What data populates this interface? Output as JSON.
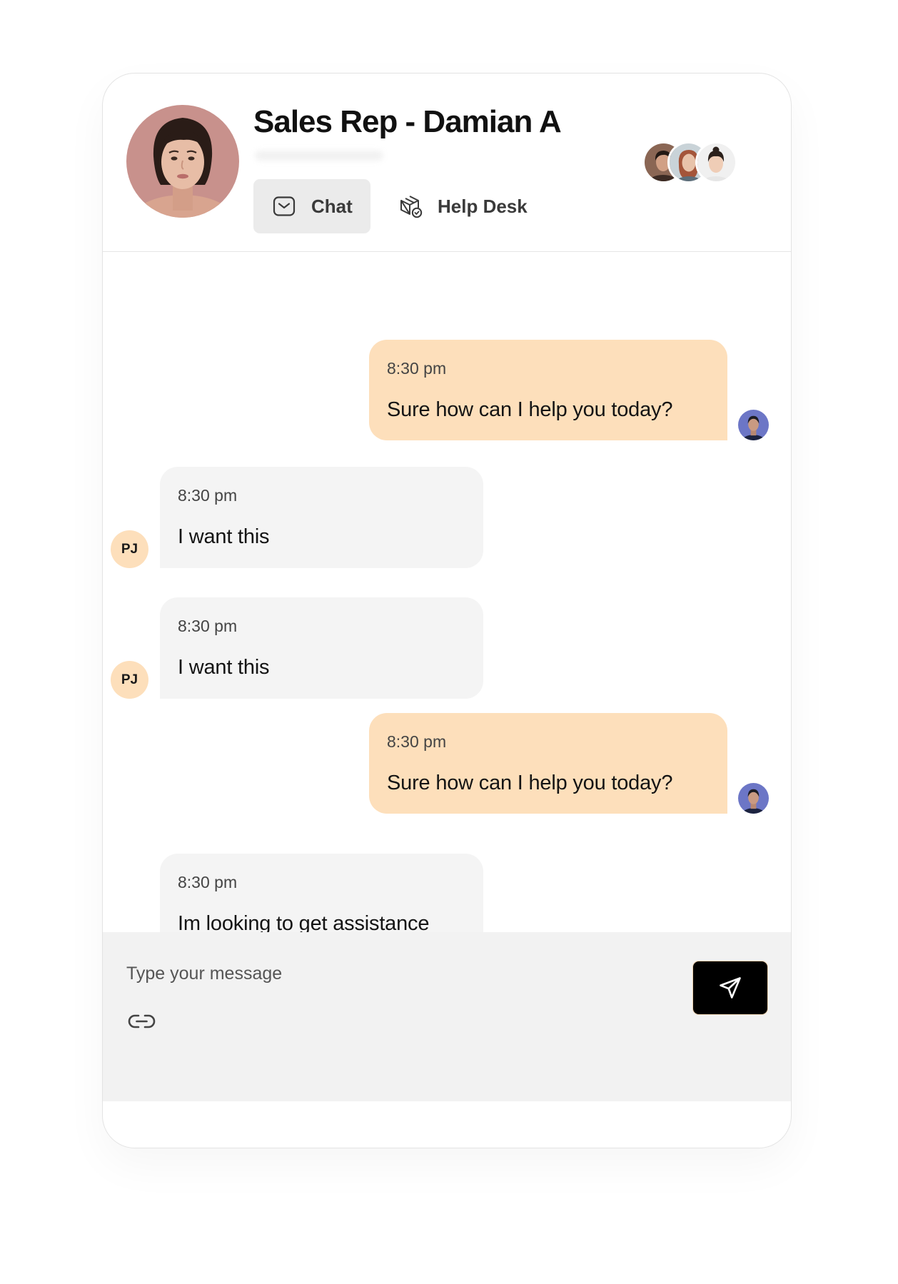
{
  "header": {
    "title": "Sales Rep - Damian A",
    "tabs": [
      {
        "label": "Chat",
        "icon": "mail-icon",
        "active": true
      },
      {
        "label": "Help Desk",
        "icon": "package-check-icon",
        "active": false
      }
    ]
  },
  "messages": [
    {
      "direction": "outgoing",
      "time": "8:30 pm",
      "text": "Sure how can I help you today?"
    },
    {
      "direction": "incoming",
      "time": "8:30 pm",
      "text": "I want this",
      "avatar_initials": "PJ"
    },
    {
      "direction": "incoming",
      "time": "8:30 pm",
      "text": "I want this",
      "avatar_initials": "PJ"
    },
    {
      "direction": "outgoing",
      "time": "8:30 pm",
      "text": "Sure how can I help you today?"
    },
    {
      "direction": "incoming",
      "time": "8:30 pm",
      "text": "Im looking to get assistance"
    }
  ],
  "composer": {
    "placeholder": "Type your message",
    "attach_icon": "link-icon",
    "send_icon": "send-icon"
  },
  "colors": {
    "outgoing_bubble": "#FDDFBB",
    "incoming_bubble": "#F4F4F4",
    "initials_avatar": "#FDDFBB",
    "active_tab": "#EBEBEB",
    "composer_bg": "#F2F2F2",
    "send_button": "#000000"
  }
}
